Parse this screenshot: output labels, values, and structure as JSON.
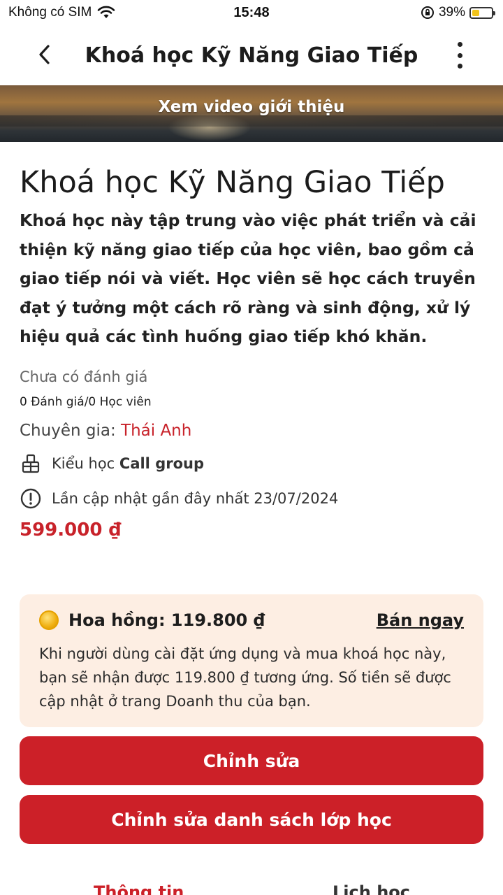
{
  "status_bar": {
    "carrier": "Không có SIM",
    "time": "15:48",
    "battery": "39%",
    "battery_level": 0.39
  },
  "header": {
    "title": "Khoá học Kỹ Năng Giao Tiếp"
  },
  "banner": {
    "label": "Xem video giới thiệu"
  },
  "course": {
    "title": "Khoá học Kỹ Năng Giao Tiếp",
    "description": "Khoá học này tập trung vào việc phát triển và cải thiện kỹ năng giao tiếp của học viên, bao gồm cả giao tiếp nói và viết. Học viên sẽ học cách truyền đạt ý tưởng một cách rõ ràng và sinh động, xử lý hiệu quả các tình huống giao tiếp khó khăn.",
    "rating_text": "Chưa có đánh giá",
    "counts": "0 Đánh giá/0 Học viên",
    "expert_label": "Chuyên gia:",
    "expert_name": "Thái Anh",
    "type_label": "Kiểu học",
    "type_value": "Call group",
    "update_text": "Lần cập nhật gần đây nhất 23/07/2024",
    "price": "599.000 ₫"
  },
  "commission": {
    "title": "Hoa hồng: 119.800 ₫",
    "sell_now": "Bán ngay",
    "text": "Khi người dùng cài đặt ứng dụng và mua khoá học này, bạn sẽ nhận được 119.800 ₫ tương ứng. Số tiền sẽ được cập nhật ở trang Doanh thu của bạn."
  },
  "buttons": {
    "edit": "Chỉnh sửa",
    "edit_class_list": "Chỉnh sửa danh sách lớp học"
  },
  "tabs": {
    "info": "Thông tin",
    "schedule": "Lịch học"
  },
  "colors": {
    "accent": "#cc2028",
    "commission_bg": "#fdeee3"
  }
}
